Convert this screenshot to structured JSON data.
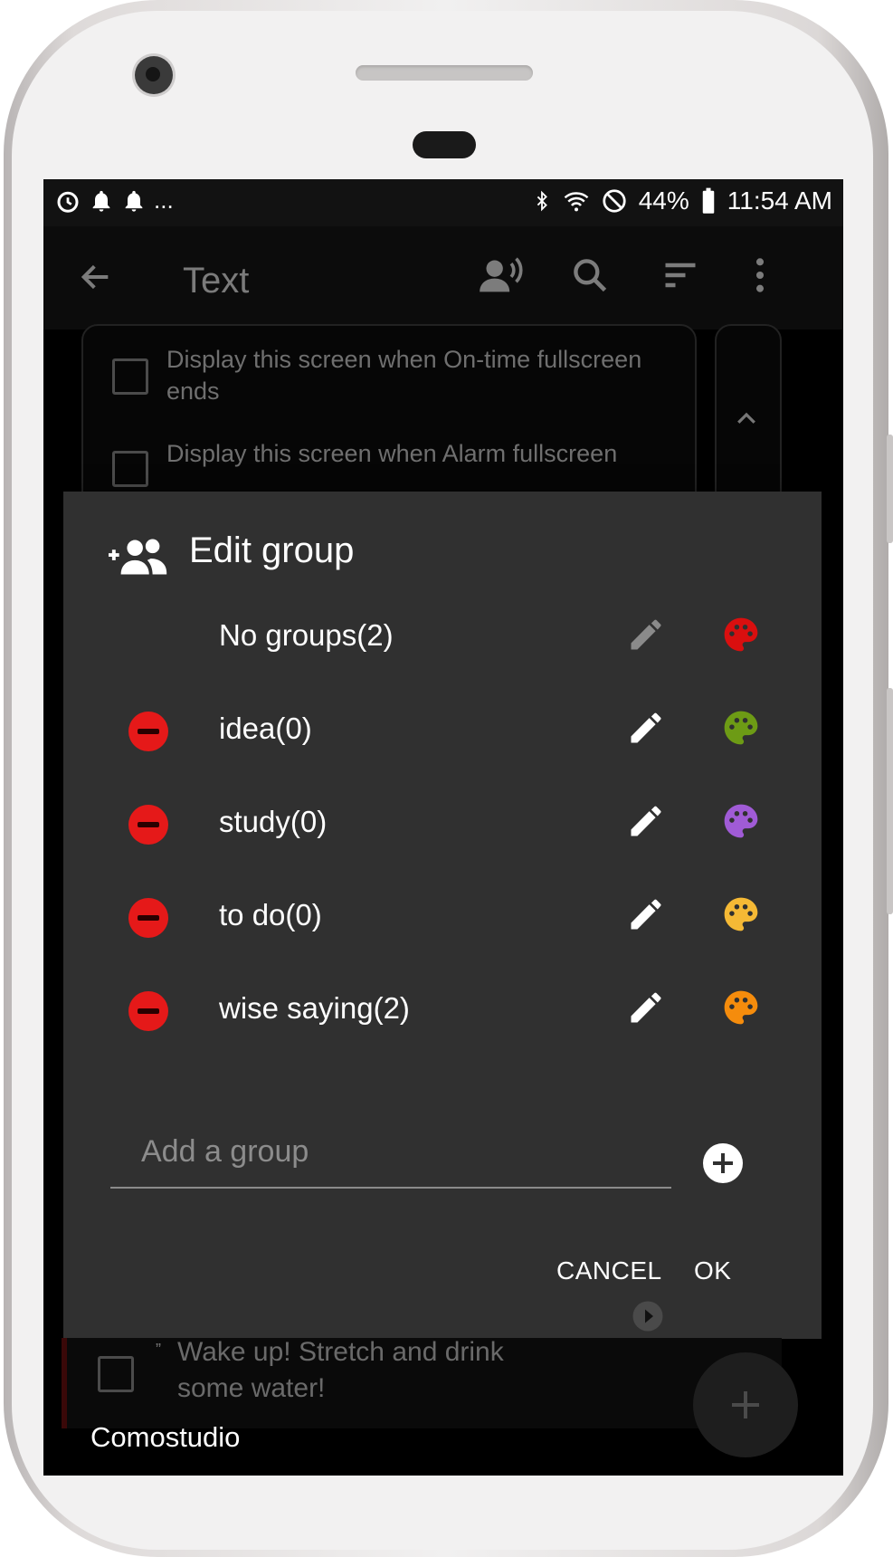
{
  "statusbar": {
    "left_more": "...",
    "battery": "44%",
    "time": "11:54 AM"
  },
  "toolbar": {
    "title": "Text"
  },
  "background": {
    "item1": "Display this screen when On-time fullscreen ends",
    "item2": "Display this screen when Alarm fullscreen",
    "bottom_item": "Wake up! Stretch and drink some water!"
  },
  "dialog": {
    "title": "Edit group",
    "groups": [
      {
        "label": "No groups(2)",
        "removable": false,
        "color": "#d90f0f",
        "edit_color": "#8a8a8a"
      },
      {
        "label": "idea(0)",
        "removable": true,
        "color": "#6d9b15",
        "edit_color": "#ffffff"
      },
      {
        "label": "study(0)",
        "removable": true,
        "color": "#a05bd6",
        "edit_color": "#ffffff"
      },
      {
        "label": "to do(0)",
        "removable": true,
        "color": "#f5b935",
        "edit_color": "#ffffff"
      },
      {
        "label": "wise saying(2)",
        "removable": true,
        "color": "#f58c0c",
        "edit_color": "#ffffff"
      }
    ],
    "add_placeholder": "Add a group",
    "cancel_label": "CANCEL",
    "ok_label": "OK"
  },
  "watermark": "Comostudio",
  "colors": {
    "remove": "#e51919",
    "dialog_bg": "#303030"
  }
}
